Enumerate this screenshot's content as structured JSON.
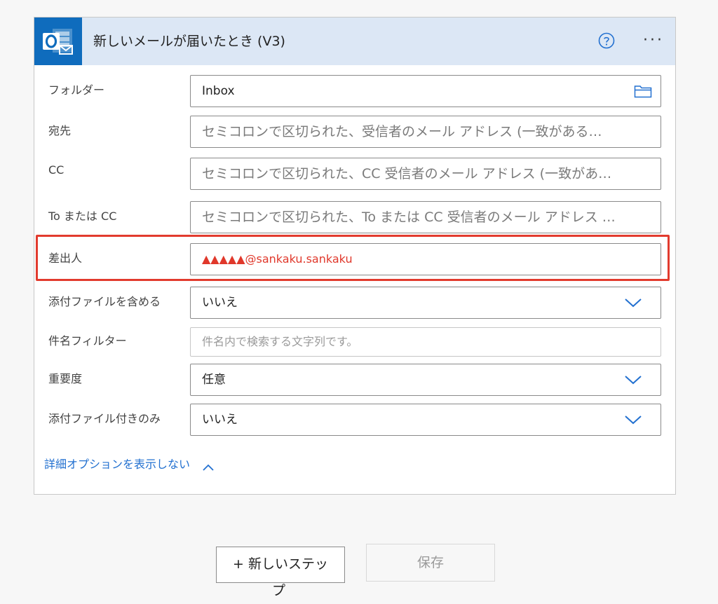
{
  "header": {
    "title": "新しいメールが届いたとき (V3)",
    "help_icon": "help-circle-icon",
    "more_icon": "more-options-icon",
    "more_glyph": "···",
    "accent": "#0f6cbd",
    "header_bg": "#dce7f5"
  },
  "fields": {
    "folder": {
      "label": "フォルダー",
      "value": "Inbox",
      "icon": "folder-icon"
    },
    "to": {
      "label": "宛先",
      "placeholder": "セミコロンで区切られた、受信者のメール アドレス (一致がある…"
    },
    "cc": {
      "label": "CC",
      "placeholder": "セミコロンで区切られた、CC 受信者のメール アドレス (一致があ…"
    },
    "to_or_cc": {
      "label": "To または CC",
      "placeholder": "セミコロンで区切られた、To または CC 受信者のメール アドレス …"
    },
    "from": {
      "label": "差出人",
      "value": "▲▲▲▲▲@sankaku.sankaku",
      "highlight_color": "#e23b2e"
    },
    "include_attachments": {
      "label": "添付ファイルを含める",
      "value": "いいえ"
    },
    "subject_filter": {
      "label": "件名フィルター",
      "placeholder": "件名内で検索する文字列です。"
    },
    "importance": {
      "label": "重要度",
      "value": "任意"
    },
    "only_with_attachments": {
      "label": "添付ファイル付きのみ",
      "value": "いいえ"
    }
  },
  "advanced_toggle": {
    "label": "詳細オプションを表示しない",
    "link_color": "#2270d0"
  },
  "buttons": {
    "new_step_line1": "+ 新しいステッ",
    "new_step_line2": "プ",
    "save": "保存"
  }
}
